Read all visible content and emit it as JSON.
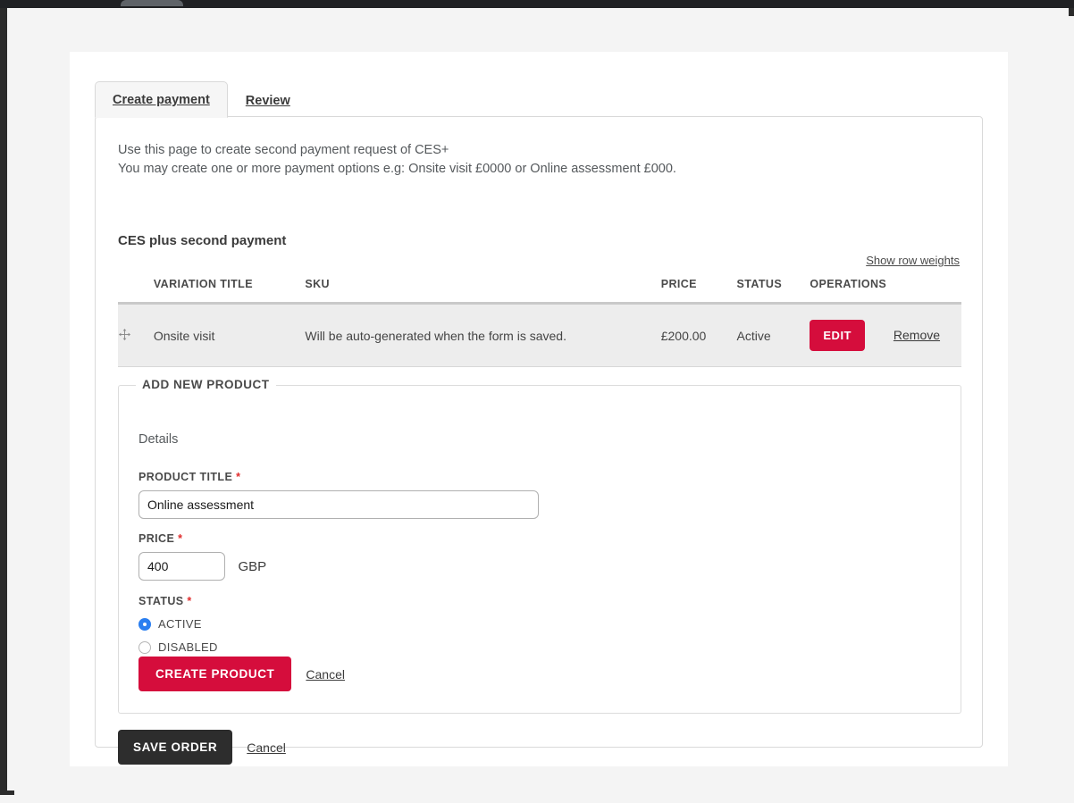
{
  "tabs": [
    {
      "label": "Create payment",
      "active": true
    },
    {
      "label": "Review",
      "active": false
    }
  ],
  "intro": {
    "line1": "Use this page to create second payment request of CES+",
    "line2": "You may create one or more payment options e.g: Onsite visit £0000 or Online assessment £000."
  },
  "section": {
    "title": "CES plus second payment",
    "row_weights_link": "Show row weights"
  },
  "table": {
    "headers": {
      "handle": "",
      "variation_title": "VARIATION TITLE",
      "sku": "SKU",
      "price": "PRICE",
      "status": "STATUS",
      "operations": "OPERATIONS"
    },
    "rows": [
      {
        "handle_icon": "drag-move-icon",
        "variation_title": "Onsite visit",
        "sku": "Will be auto-generated when the form is saved.",
        "price": "£200.00",
        "status": "Active",
        "edit_label": "EDIT",
        "remove_label": "Remove"
      }
    ]
  },
  "fieldset": {
    "legend": "ADD NEW PRODUCT",
    "details_label": "Details",
    "product_title": {
      "label": "PRODUCT TITLE",
      "required_marker": "*",
      "value": "Online assessment",
      "placeholder": ""
    },
    "price": {
      "label": "PRICE",
      "required_marker": "*",
      "value": "400",
      "placeholder": "",
      "currency": "GBP"
    },
    "status": {
      "label": "STATUS",
      "required_marker": "*",
      "options": [
        {
          "label": "ACTIVE",
          "checked": true
        },
        {
          "label": "DISABLED",
          "checked": false
        }
      ]
    },
    "create_button": "CREATE PRODUCT",
    "cancel_link": "Cancel"
  },
  "footer": {
    "save_button": "SAVE ORDER",
    "cancel_link": "Cancel"
  },
  "colors": {
    "accent_red": "#d50d3c",
    "dark_button": "#2d2d2d",
    "radio_blue": "#2a7ef0",
    "required_red": "#e02c2c",
    "page_background": "#f4f4f4",
    "row_background": "#ededed"
  }
}
